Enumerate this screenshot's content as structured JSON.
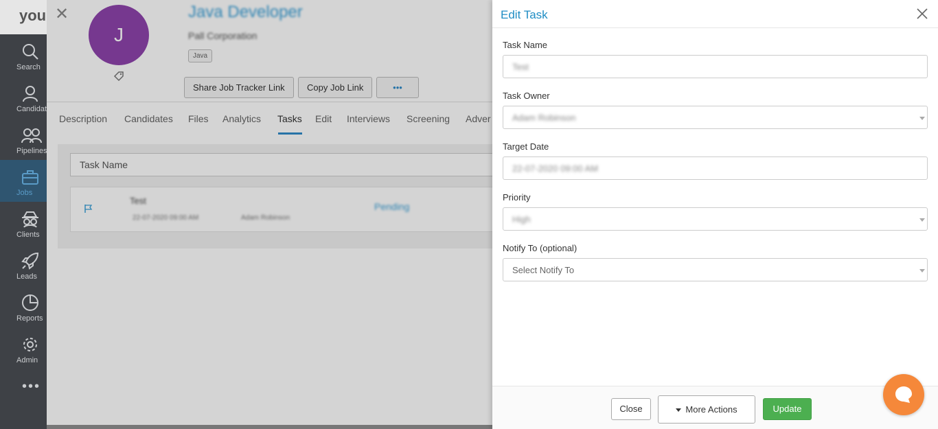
{
  "sidebar": {
    "brand": "youi",
    "items": [
      {
        "label": "Search",
        "icon": "search-icon"
      },
      {
        "label": "Candidates",
        "icon": "person-icon"
      },
      {
        "label": "Pipelines",
        "icon": "people-icon"
      },
      {
        "label": "Jobs",
        "icon": "briefcase-icon"
      },
      {
        "label": "Clients",
        "icon": "spy-icon"
      },
      {
        "label": "Leads",
        "icon": "rocket-icon"
      },
      {
        "label": "Reports",
        "icon": "pie-chart-icon"
      },
      {
        "label": "Admin",
        "icon": "gear-icon"
      }
    ],
    "more": "•••"
  },
  "job": {
    "avatar_letter": "J",
    "title": "Java Developer",
    "company": "Pall Corporation",
    "skill": "Java",
    "buttons": {
      "share": "Share Job Tracker Link",
      "copy": "Copy Job Link",
      "more": "•••"
    },
    "tabs": [
      "Description",
      "Candidates",
      "Files",
      "Analytics",
      "Tasks",
      "Edit",
      "Interviews",
      "Screening",
      "Adver"
    ],
    "active_tab": "Tasks",
    "task_search_placeholder": "Task Name",
    "task_row": {
      "name": "Test",
      "date": "22-07-2020 09:00 AM",
      "owner": "Adam Robinson",
      "status": "Pending"
    }
  },
  "drawer": {
    "title": "Edit Task",
    "fields": {
      "task_name": {
        "label": "Task Name",
        "value": "Test"
      },
      "task_owner": {
        "label": "Task Owner",
        "value": "Adam Robinson"
      },
      "target_date": {
        "label": "Target Date",
        "value": "22-07-2020 09:00 AM"
      },
      "priority": {
        "label": "Priority",
        "value": "High"
      },
      "notify_to": {
        "label": "Notify To (optional)",
        "placeholder": "Select Notify To"
      }
    },
    "footer": {
      "close": "Close",
      "more_actions": "More Actions",
      "update": "Update"
    }
  },
  "colors": {
    "accent": "#1f8dc4",
    "avatar": "#8e44ad",
    "update": "#4caf50",
    "chat": "#f5883a"
  }
}
